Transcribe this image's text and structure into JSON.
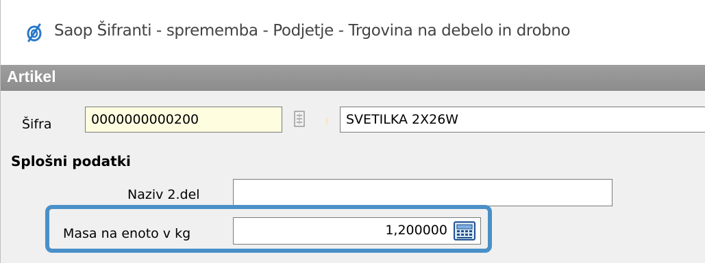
{
  "window": {
    "title": "Saop Šifranti - sprememba - Podjetje - Trgovina na debelo in drobno",
    "icon": "saop-logo-icon"
  },
  "section": {
    "title": "Artikel"
  },
  "code_row": {
    "label": "Šifra",
    "code_value": "0000000000200",
    "lookup_icon": "lookup-icon",
    "name_value": "SVETILKA 2X26W"
  },
  "general": {
    "title": "Splošni podatki",
    "name2_label": "Naziv 2.del",
    "name2_value": "",
    "mass_label": "Masa na enoto v kg",
    "mass_value": "1,200000",
    "calculator_icon": "calculator-icon"
  },
  "colors": {
    "section_header": "#939393",
    "highlight": "#4a90c8",
    "code_field_bg": "#fffde0"
  }
}
